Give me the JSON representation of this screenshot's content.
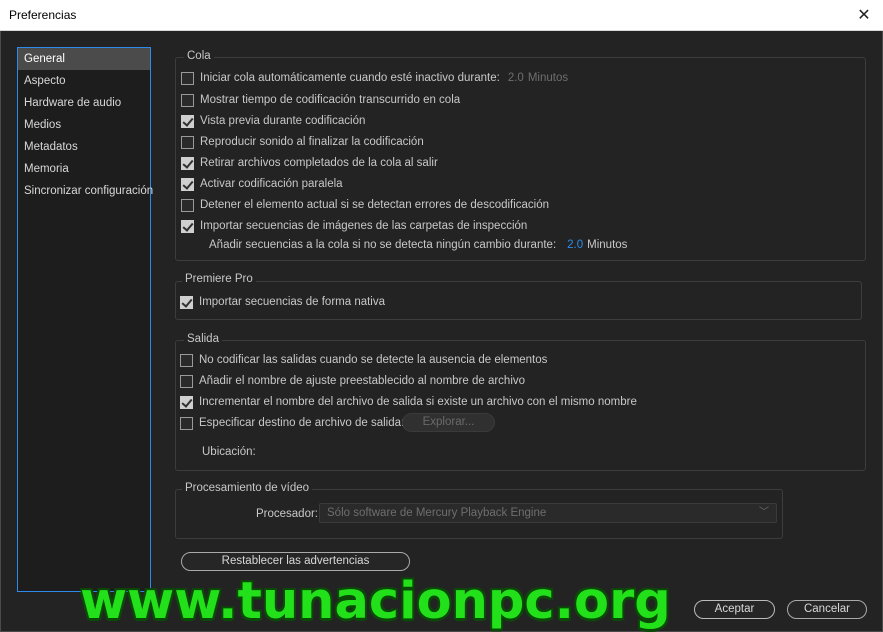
{
  "window": {
    "title": "Preferencias"
  },
  "sidebar": {
    "items": [
      {
        "label": "General"
      },
      {
        "label": "Aspecto"
      },
      {
        "label": "Hardware de audio"
      },
      {
        "label": "Medios"
      },
      {
        "label": "Metadatos"
      },
      {
        "label": "Memoria"
      },
      {
        "label": "Sincronizar configuración"
      }
    ]
  },
  "cola": {
    "legend": "Cola",
    "options": [
      {
        "label": "Iniciar cola automáticamente cuando esté inactivo durante:",
        "checked": false,
        "value": "2.0",
        "unit": "Minutos"
      },
      {
        "label": "Mostrar tiempo de codificación transcurrido en cola",
        "checked": false
      },
      {
        "label": "Vista previa durante codificación",
        "checked": true
      },
      {
        "label": "Reproducir sonido al finalizar la codificación",
        "checked": false
      },
      {
        "label": "Retirar archivos completados de la cola al salir",
        "checked": true
      },
      {
        "label": "Activar codificación paralela",
        "checked": true
      },
      {
        "label": "Detener el elemento actual si se detectan errores de descodificación",
        "checked": false
      },
      {
        "label": "Importar secuencias de imágenes de las carpetas de inspección",
        "checked": true
      }
    ],
    "sub": {
      "label": "Añadir secuencias a la cola si no se detecta ningún cambio durante:",
      "value": "2.0",
      "unit": "Minutos"
    }
  },
  "premiere": {
    "legend": "Premiere Pro",
    "options": [
      {
        "label": "Importar secuencias de forma nativa",
        "checked": true
      }
    ]
  },
  "salida": {
    "legend": "Salida",
    "options": [
      {
        "label": "No codificar las salidas cuando se detecte la ausencia de elementos",
        "checked": false
      },
      {
        "label": "Añadir el nombre de ajuste preestablecido al nombre de archivo",
        "checked": false
      },
      {
        "label": "Incrementar el nombre del archivo de salida si existe un archivo con el mismo nombre",
        "checked": true
      },
      {
        "label": "Especificar destino de archivo de salida:",
        "checked": false
      }
    ],
    "browse_label": "Explorar...",
    "location_label": "Ubicación:"
  },
  "video": {
    "legend": "Procesamiento de vídeo",
    "processor_label": "Procesador:",
    "processor_value": "Sólo software de Mercury Playback Engine"
  },
  "buttons": {
    "reset_warnings": "Restablecer las advertencias",
    "accept": "Aceptar",
    "cancel": "Cancelar"
  },
  "watermark": "www.tunacionpc.org",
  "colors": {
    "accent": "#2d8ceb",
    "background": "#232323",
    "watermark": "#22e01a"
  }
}
